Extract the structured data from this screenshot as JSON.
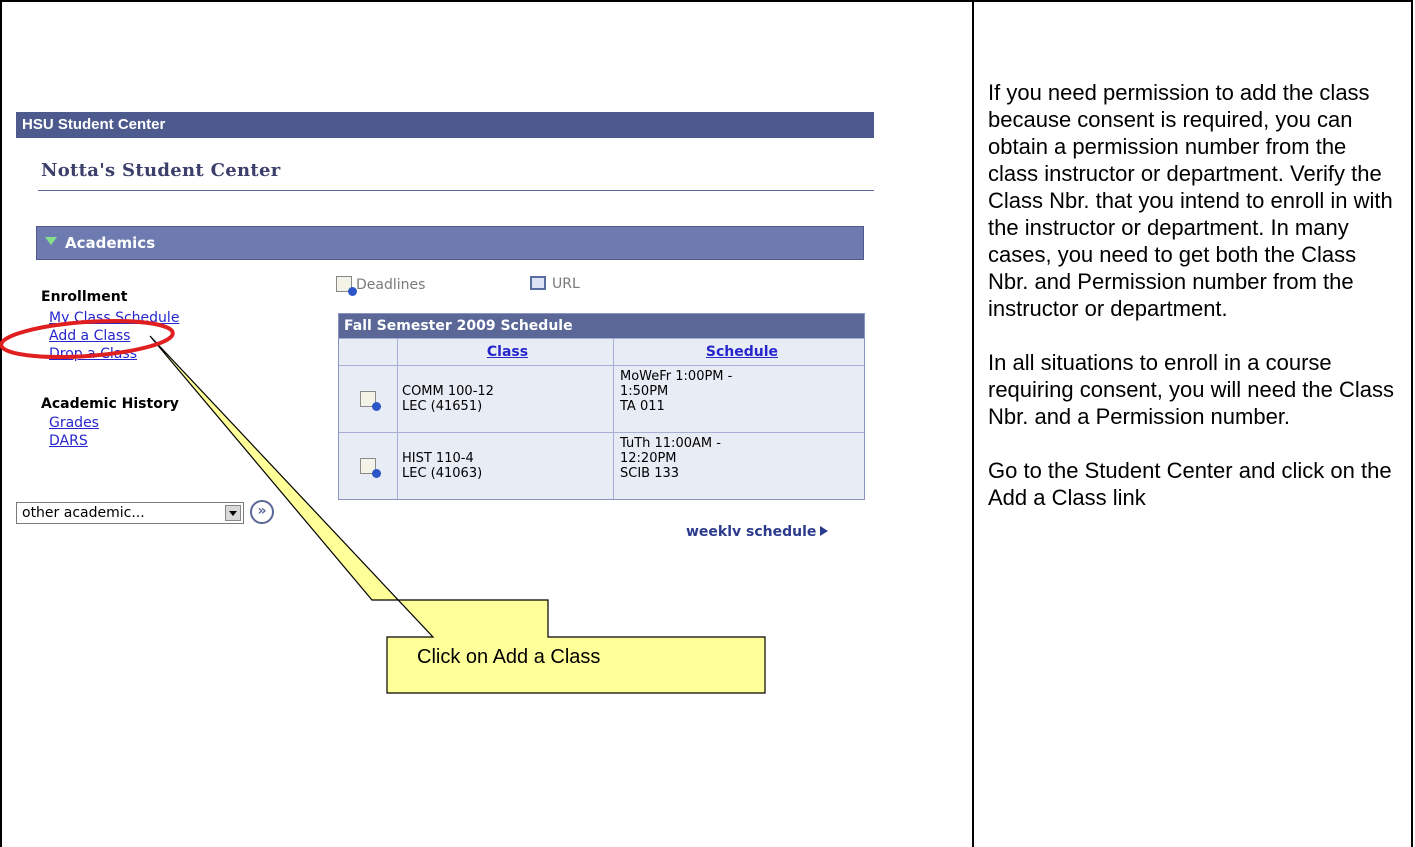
{
  "screenshot": {
    "app_title": "HSU Student Center",
    "page_title": "Notta's Student Center",
    "section_title": "Academics",
    "enrollment": {
      "heading": "Enrollment",
      "links": [
        "My Class Schedule",
        "Add a Class",
        "Drop a Class"
      ]
    },
    "history": {
      "heading": "Academic History",
      "links": [
        "Grades",
        "DARS"
      ]
    },
    "top_links": {
      "deadlines": "Deadlines",
      "url": "URL"
    },
    "schedule": {
      "title": "Fall Semester 2009 Schedule",
      "col_class": "Class",
      "col_schedule": "Schedule",
      "rows": [
        {
          "class_line1": "COMM 100-12",
          "class_line2": "LEC (41651)",
          "sched_line1": "MoWeFr 1:00PM -",
          "sched_line2": "1:50PM",
          "sched_line3": "TA 011"
        },
        {
          "class_line1": "HIST 110-4",
          "class_line2": "LEC (41063)",
          "sched_line1": "TuTh 11:00AM -",
          "sched_line2": "12:20PM",
          "sched_line3": "SCIB 133"
        }
      ],
      "weekly_link": "weekly schedule"
    },
    "dropdown_value": "other academic...",
    "go_label": "»"
  },
  "callout": "Click on Add a Class",
  "instructions": {
    "p1": "If you need permission to add the class because consent is required, you can obtain a permission number from the class instructor or department. Verify the Class Nbr. that you intend to enroll in with the instructor or department. In many cases, you need to get both the Class Nbr. and Permission number from the instructor or department.",
    "p2": "In all situations to enroll in a course requiring consent, you will need the Class Nbr. and a Permission number.",
    "p3": "Go to the Student Center and click on the Add a Class link"
  },
  "colors": {
    "header_bar": "#4d5a8e",
    "section_bar": "#6e7bb0",
    "link": "#2626cc",
    "callout_fill": "#ffff99",
    "highlight_ellipse": "#e02020"
  }
}
